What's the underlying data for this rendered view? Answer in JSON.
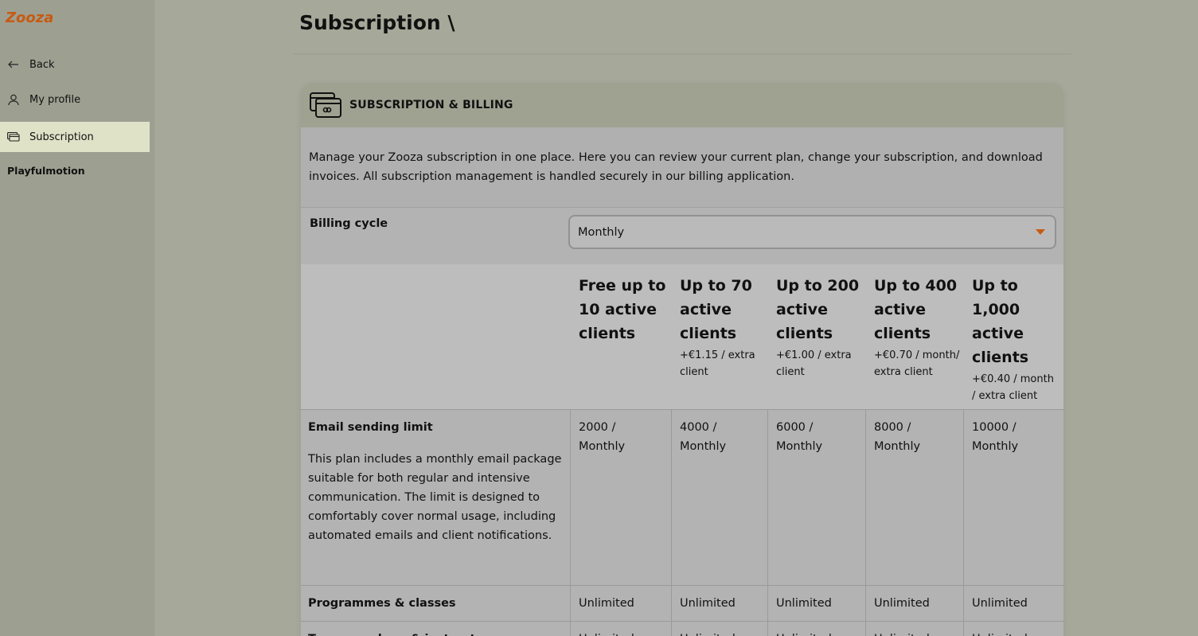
{
  "sidebar": {
    "logo_text": "Zooza",
    "items": [
      {
        "label": "Back",
        "icon": "arrow-left-icon"
      },
      {
        "label": "My profile",
        "icon": "user-icon"
      },
      {
        "label": "Subscription",
        "icon": "credit-card-icon",
        "active": true
      }
    ],
    "org_name": "Playfulmotion"
  },
  "header": {
    "title": "Subscription \\"
  },
  "card": {
    "title": "SUBSCRIPTION & BILLING",
    "intro": "Manage your Zooza subscription in one place. Here you can review your current plan, change your subscription, and download invoices. All subscription management is handled securely in our billing application.",
    "billing_cycle": {
      "label": "Billing cycle",
      "value": "Monthly"
    }
  },
  "plans": [
    {
      "name": "Free up to 10 active clients",
      "extra": ""
    },
    {
      "name": "Up to 70 active clients",
      "extra": "+€1.15 / extra client"
    },
    {
      "name": "Up to 200 active clients",
      "extra": "+€1.00 / extra client"
    },
    {
      "name": "Up to 400 active clients",
      "extra": "+€0.70 / month/ extra client"
    },
    {
      "name": "Up to 1,000 active clients",
      "extra": "+€0.40 / month / extra client"
    }
  ],
  "features": [
    {
      "label": "Email sending limit",
      "description": "This plan includes a monthly email package suitable for both regular and intensive communication. The limit is designed to comfortably cover normal usage, including automated emails and client notifications.",
      "values": [
        "2000 / Monthly",
        "4000 / Monthly",
        "6000 / Monthly",
        "8000 / Monthly",
        "10000 / Monthly"
      ]
    },
    {
      "label": "Programmes & classes",
      "description": "",
      "values": [
        "Unlimited",
        "Unlimited",
        "Unlimited",
        "Unlimited",
        "Unlimited"
      ]
    },
    {
      "label": "Team members & instructors",
      "description": "",
      "values": [
        "Unlimited",
        "Unlimited",
        "Unlimited",
        "Unlimited",
        "Unlimited"
      ]
    }
  ],
  "colors": {
    "accent": "#c75a12",
    "active_nav": "#dfe2c7"
  }
}
